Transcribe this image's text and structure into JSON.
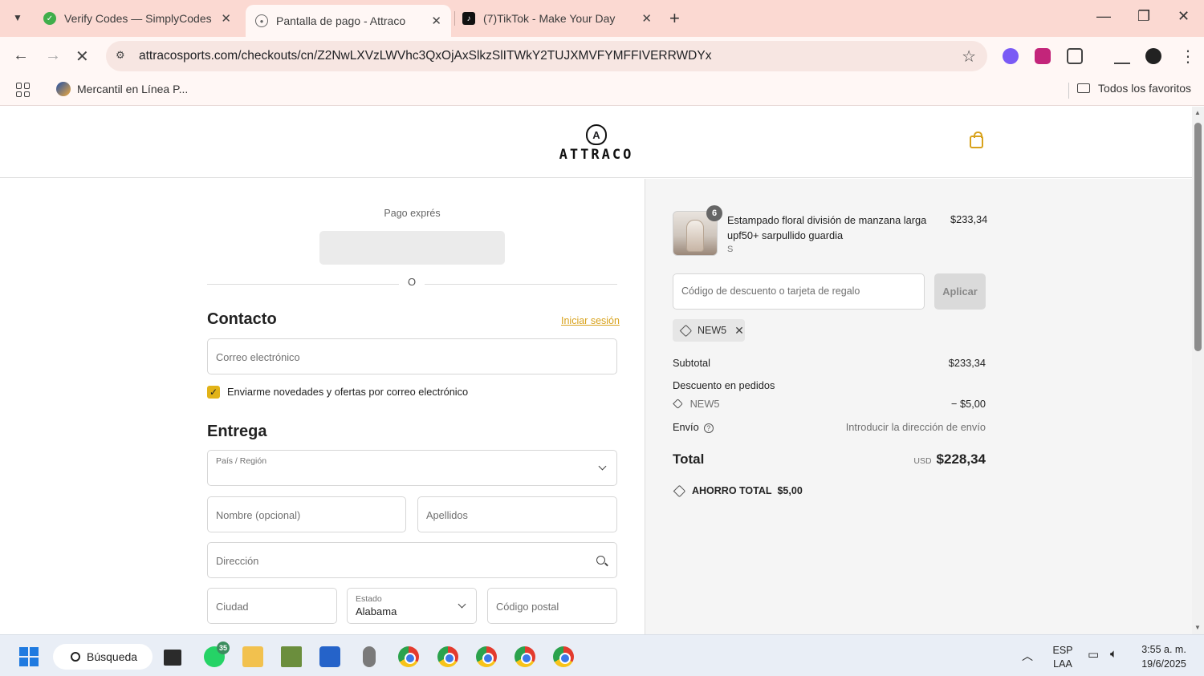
{
  "browser": {
    "tabs": [
      {
        "title": "Verify Codes — SimplyCodes",
        "active": false
      },
      {
        "title": "Pantalla de pago - Attraco",
        "active": true
      },
      {
        "title": "(7)TikTok - Make Your Day",
        "active": false
      }
    ],
    "url": "attracosports.com/checkouts/cn/Z2NwLXVzLWVhc3QxOjAxSlkzSlITWkY2TUJXMVFYMFFIVERRWDYx",
    "bookmarks": [
      {
        "label": "Mercantil en Línea P..."
      }
    ],
    "all_bookmarks_label": "Todos los favoritos"
  },
  "site": {
    "logo_text": "ATTRACO"
  },
  "checkout": {
    "express_label": "Pago exprés",
    "or_text": "O",
    "contact_heading": "Contacto",
    "login_link": "Iniciar sesión",
    "email_placeholder": "Correo electrónico",
    "newsletter_label": "Enviarme novedades y ofertas por correo electrónico",
    "newsletter_checked": true,
    "delivery_heading": "Entrega",
    "country_label": "País / Región",
    "first_name_placeholder": "Nombre (opcional)",
    "last_name_placeholder": "Apellidos",
    "address_placeholder": "Dirección",
    "city_placeholder": "Ciudad",
    "state_label": "Estado",
    "state_value": "Alabama",
    "postal_placeholder": "Código postal"
  },
  "summary": {
    "product": {
      "quantity": "6",
      "name": "Estampado floral división de manzana larga upf50+ sarpullido guardia",
      "variant": "S",
      "price": "$233,34"
    },
    "discount_placeholder": "Código de descuento o tarjeta de regalo",
    "apply_label": "Aplicar",
    "applied_code": "NEW5",
    "subtotal_label": "Subtotal",
    "subtotal_value": "$233,34",
    "order_discount_label": "Descuento en pedidos",
    "discount_code": "NEW5",
    "discount_value": "− $5,00",
    "shipping_label": "Envío",
    "shipping_value": "Introducir la dirección de envío",
    "total_label": "Total",
    "total_currency": "USD",
    "total_value": "$228,34",
    "savings_label": "AHORRO TOTAL",
    "savings_value": "$5,00"
  },
  "taskbar": {
    "search_label": "Búsqueda",
    "whatsapp_badge": "35",
    "lang_top": "ESP",
    "lang_bottom": "LAA",
    "time": "3:55 a. m.",
    "date": "19/6/2025"
  },
  "colors": {
    "accent": "#d8a21c",
    "tabstrip": "#fbd9d2",
    "checkbox": "#e2b318"
  }
}
